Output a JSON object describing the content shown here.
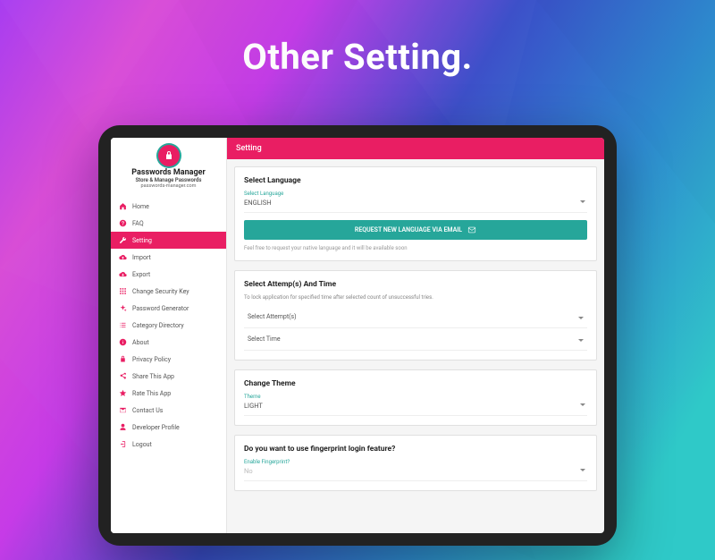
{
  "hero": {
    "title": "Other Setting."
  },
  "app": {
    "name": "Passwords Manager",
    "tagline": "Store & Manage Passwords",
    "url": "passwords-manager.com"
  },
  "nav": [
    {
      "icon": "home",
      "label": "Home"
    },
    {
      "icon": "help",
      "label": "FAQ"
    },
    {
      "icon": "wrench",
      "label": "Setting",
      "active": true
    },
    {
      "icon": "cloud-up",
      "label": "Import"
    },
    {
      "icon": "cloud-down",
      "label": "Export"
    },
    {
      "icon": "grid",
      "label": "Change Security Key"
    },
    {
      "icon": "sparkle",
      "label": "Password Generator"
    },
    {
      "icon": "list",
      "label": "Category Directory"
    },
    {
      "icon": "info",
      "label": "About"
    },
    {
      "icon": "lock",
      "label": "Privacy Policy"
    },
    {
      "icon": "share",
      "label": "Share This App"
    },
    {
      "icon": "star",
      "label": "Rate This App"
    },
    {
      "icon": "mail",
      "label": "Contact Us"
    },
    {
      "icon": "user",
      "label": "Developer Profile"
    },
    {
      "icon": "logout",
      "label": "Logout"
    }
  ],
  "topbar": {
    "title": "Setting"
  },
  "lang": {
    "title": "Select Language",
    "label": "Select Language",
    "value": "ENGLISH",
    "button": "REQUEST NEW LANGUAGE VIA EMAIL",
    "hint": "Feel free to request your native language and it will be available soon"
  },
  "attempts": {
    "title": "Select Attemp(s) And Time",
    "desc": "To lock application for specified time after selected count of unsuccessful tries.",
    "attemptsLabel": "Select Attempt(s)",
    "timeLabel": "Select Time"
  },
  "theme": {
    "title": "Change Theme",
    "label": "Theme",
    "value": "LIGHT"
  },
  "fingerprint": {
    "title": "Do you want to use fingerprint login feature?",
    "label": "Enable Fingerprint?",
    "value": "No"
  }
}
